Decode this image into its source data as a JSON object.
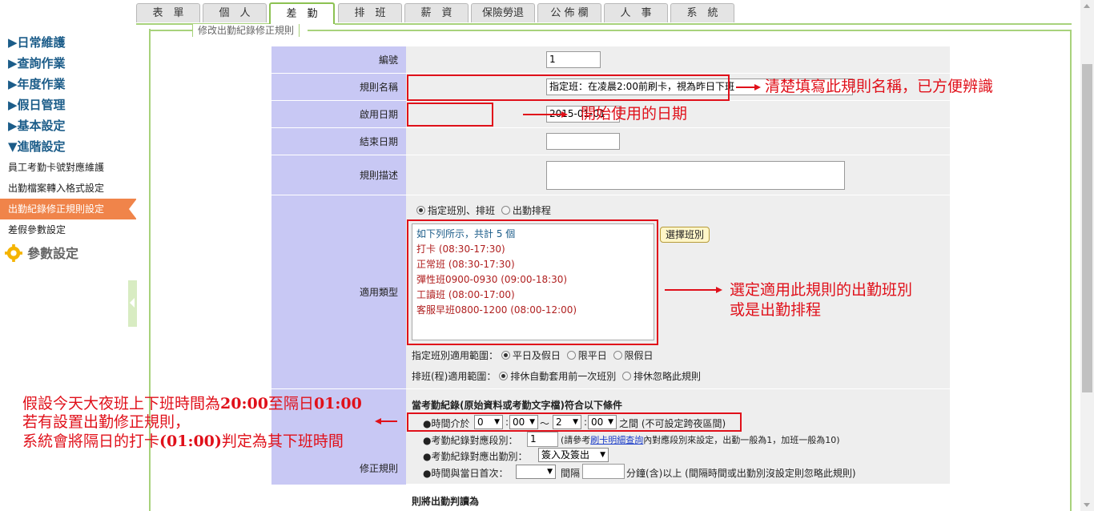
{
  "tabs": [
    "表　單",
    "個　人",
    "差　勤",
    "排　班",
    "薪　資",
    "保險勞退",
    "公 佈 欄",
    "人　事",
    "系　統"
  ],
  "sidebar": {
    "categories": [
      "▶日常維護",
      "▶查詢作業",
      "▶年度作業",
      "▶假日管理",
      "▶基本設定",
      "▼進階設定"
    ],
    "items": [
      "員工考勤卡號對應維護",
      "出勤檔案轉入格式設定",
      "出勤紀錄修正規則設定",
      "差假參數設定"
    ],
    "param_label": "參數設定"
  },
  "legend": "修改出勤紀錄修正規則",
  "form": {
    "id_label": "編號",
    "id_value": "1",
    "name_label": "規則名稱",
    "name_value": "指定班：在凌晨2:00前刷卡，視為昨日下班",
    "start_label": "啟用日期",
    "start_value": "2015-01-01",
    "end_label": "結束日期",
    "end_value": "",
    "desc_label": "規則描述",
    "type_label": "適用類型",
    "type_opt1": "指定班別、排班",
    "type_opt2": "出勤排程",
    "list_header": "如下列所示，共計 5 個",
    "shifts": [
      "打卡 (08:30-17:30)",
      "正常班 (08:30-17:30)",
      "彈性班0900-0930 (09:00-18:30)",
      "工讀班 (08:00-17:00)",
      "客服早班0800-1200 (08:00-12:00)"
    ],
    "choose_shift": "選擇班別",
    "scope_label": "指定班別適用範圍：",
    "scope_opt1": "平日及假日",
    "scope_opt2": "限平日",
    "scope_opt3": "限假日",
    "sched_label": "排班(程)適用範圍：",
    "sched_opt1": "排休自動套用前一次班別",
    "sched_opt2": "排休忽略此規則",
    "rule_label": "修正規則",
    "cond_title": "當考勤紀錄(原始資料或考勤文字檔)符合以下條件",
    "time_between": "●時間介於",
    "t1h": "0",
    "t1m": "00",
    "tilde": "～",
    "t2h": "2",
    "t2m": "00",
    "time_between_end": "之間 (不可設定跨夜區間)",
    "seg_label": "●考勤紀錄對應段別：",
    "seg_value": "1",
    "seg_note_pre": "(請參考",
    "seg_link": "刷卡明細查詢",
    "seg_note_post": "內對應段別來設定，出勤一般為1，加班一般為10)",
    "inout_label": "●考勤紀錄對應出勤別：",
    "inout_value": "簽入及簽出",
    "first_label": "●時間與當日首次：",
    "first_mid": "間隔",
    "first_post": "分鐘(含)以上 (間隔時間或出勤別沒設定則忽略此規則)",
    "then_title": "則將出勤判讀為"
  },
  "annotations": {
    "name": "清楚填寫此規則名稱，已方便辨識",
    "start": "開始使用的日期",
    "shift1": "選定適用此規則的出勤班別",
    "shift2": "或是出勤排程",
    "night1_a": "假設今天大夜班上下班時間為",
    "night1_b": "20:00",
    "night1_c": "至隔日",
    "night1_d": "01:00",
    "night2": "若有設置出勤修正規則，",
    "night3_a": "系統會將隔日的打卡",
    "night3_b": "(01:00)",
    "night3_c": "判定為其下班時間"
  }
}
